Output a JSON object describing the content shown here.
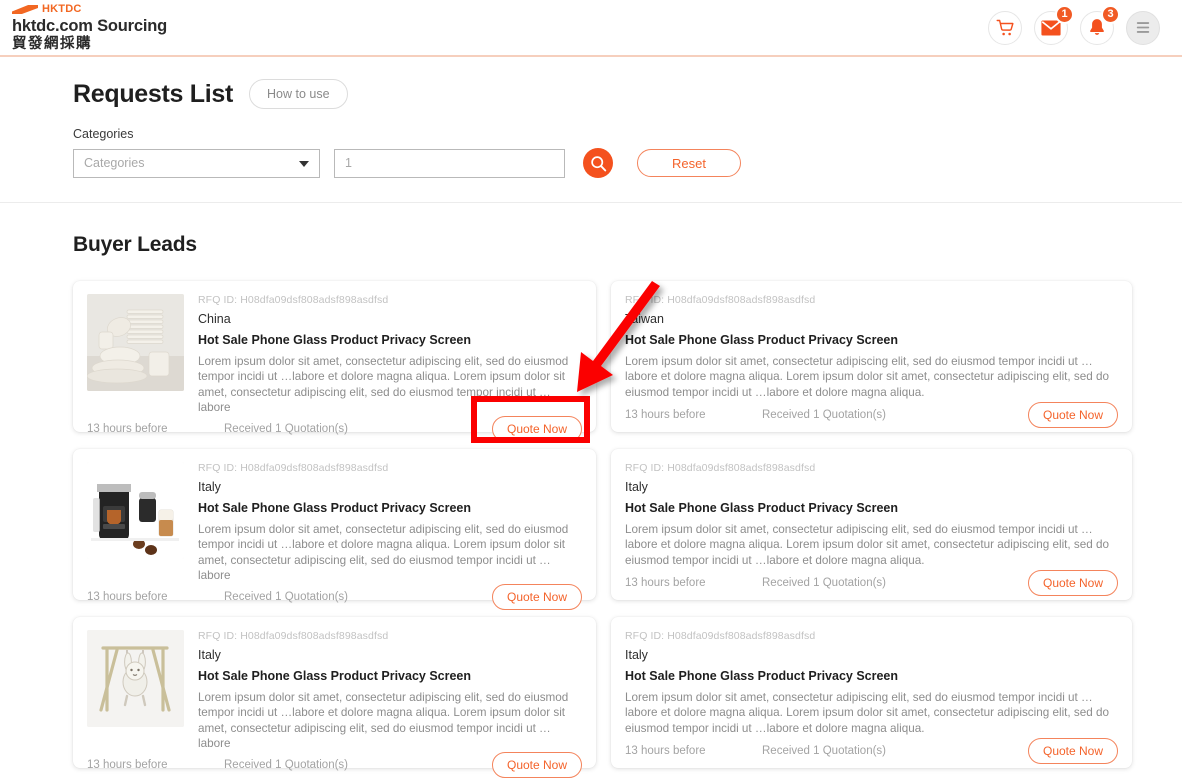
{
  "header": {
    "logo_mark": "hktdc-swoosh-logo",
    "logo_text": "HKTDC",
    "title": "hktdc.com Sourcing",
    "subtitle": "貿發網採購",
    "actions": [
      {
        "name": "cart-icon",
        "label": "Shopping Cart",
        "badge": ""
      },
      {
        "name": "mail-icon",
        "label": "Messages",
        "badge": "1"
      },
      {
        "name": "bell-icon",
        "label": "Notifications",
        "badge": "3"
      },
      {
        "name": "hamburger-menu-icon",
        "label": "Menu",
        "badge": ""
      }
    ]
  },
  "filters": {
    "page_title": "Requests List",
    "how_to_use": "How to use",
    "categories_label": "Categories",
    "categories_placeholder": "Categories",
    "keyword_value": "1",
    "keyword_placeholder": "1",
    "search_icon": "search-icon",
    "reset_label": "Reset"
  },
  "leads": {
    "section_title": "Buyer Leads",
    "cards": [
      {
        "rfq_id": "RFQ ID: H08dfa09dsf808adsf898asdfsd",
        "country": "China",
        "title": "Hot Sale Phone Glass Product Privacy Screen",
        "desc": "Lorem ipsum dolor sit amet, consectetur adipiscing elit, sed do eiusmod tempor incidi ut …labore et dolore magna aliqua. Lorem ipsum dolor sit amet, consectetur adipiscing elit, sed do eiusmod tempor incidi ut …labore",
        "time": "13 hours before",
        "quotations": "Received 1 Quotation(s)",
        "quote_label": "Quote Now",
        "thumb": "dinnerware-set-photo"
      },
      {
        "rfq_id": "RFQ ID: H08dfa09dsf808adsf898asdfsd",
        "country": "Taiwan",
        "title": "Hot Sale Phone Glass Product Privacy Screen",
        "desc": "Lorem ipsum dolor sit amet, consectetur adipiscing elit, sed do eiusmod tempor incidi ut …labore et dolore magna aliqua. Lorem ipsum dolor sit amet, consectetur adipiscing elit, sed do eiusmod tempor incidi ut …labore et dolore magna aliqua.",
        "time": "13 hours before",
        "quotations": "Received 1 Quotation(s)",
        "quote_label": "Quote Now",
        "thumb": ""
      },
      {
        "rfq_id": "RFQ ID: H08dfa09dsf808adsf898asdfsd",
        "country": "Italy",
        "title": "Hot Sale Phone Glass Product Privacy Screen",
        "desc": "Lorem ipsum dolor sit amet, consectetur adipiscing elit, sed do eiusmod tempor incidi ut …labore et dolore magna aliqua. Lorem ipsum dolor sit amet, consectetur adipiscing elit, sed do eiusmod tempor incidi ut …labore",
        "time": "13 hours before",
        "quotations": "Received 1 Quotation(s)",
        "quote_label": "Quote Now",
        "thumb": "coffee-machine-photo"
      },
      {
        "rfq_id": "RFQ ID: H08dfa09dsf808adsf898asdfsd",
        "country": "Italy",
        "title": "Hot Sale Phone Glass Product Privacy Screen",
        "desc": "Lorem ipsum dolor sit amet, consectetur adipiscing elit, sed do eiusmod tempor incidi ut …labore et dolore magna aliqua. Lorem ipsum dolor sit amet, consectetur adipiscing elit, sed do eiusmod tempor incidi ut …labore et dolore magna aliqua.",
        "time": "13 hours before",
        "quotations": "Received 1 Quotation(s)",
        "quote_label": "Quote Now",
        "thumb": ""
      },
      {
        "rfq_id": "RFQ ID: H08dfa09dsf808adsf898asdfsd",
        "country": "Italy",
        "title": "Hot Sale Phone Glass Product Privacy Screen",
        "desc": "Lorem ipsum dolor sit amet, consectetur adipiscing elit, sed do eiusmod tempor incidi ut …labore et dolore magna aliqua. Lorem ipsum dolor sit amet, consectetur adipiscing elit, sed do eiusmod tempor incidi ut …labore",
        "time": "13 hours before",
        "quotations": "Received 1 Quotation(s)",
        "quote_label": "Quote Now",
        "thumb": "baby-swing-photo"
      },
      {
        "rfq_id": "RFQ ID: H08dfa09dsf808adsf898asdfsd",
        "country": "Italy",
        "title": "Hot Sale Phone Glass Product Privacy Screen",
        "desc": "Lorem ipsum dolor sit amet, consectetur adipiscing elit, sed do eiusmod tempor incidi ut …labore et dolore magna aliqua. Lorem ipsum dolor sit amet, consectetur adipiscing elit, sed do eiusmod tempor incidi ut …labore et dolore magna aliqua.",
        "time": "13 hours before",
        "quotations": "Received 1 Quotation(s)",
        "quote_label": "Quote Now",
        "thumb": ""
      }
    ]
  },
  "annotations": {
    "highlight_box": "red-highlight-box-quote-now",
    "arrow": "red-arrow-pointing-to-quote-now"
  },
  "colors": {
    "brand_orange": "#f26722",
    "accent_orange": "#f4632b",
    "search_orange": "#f4511e",
    "annotation_red": "#fb0000",
    "badge_orange": "#f15a24"
  }
}
